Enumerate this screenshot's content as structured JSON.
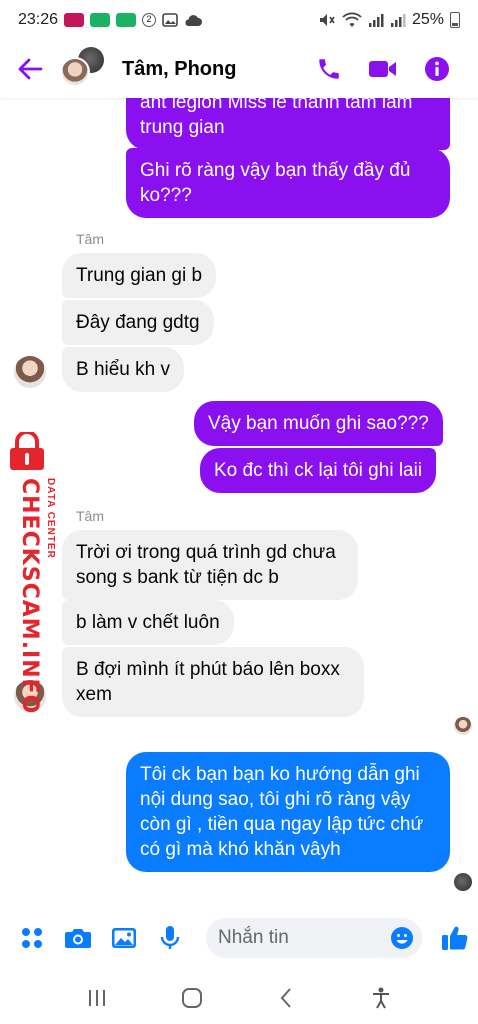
{
  "status_bar": {
    "time": "23:26",
    "battery": "25%"
  },
  "header": {
    "title": "Tâm, Phong"
  },
  "colors": {
    "accent": "#8a10f0",
    "outgoing_purple": "#8a10f0",
    "outgoing_blue": "#0a7cff",
    "incoming_bg": "#f0f0f0",
    "watermark_red": "#e4262c"
  },
  "messages": [
    {
      "text": "ant legion Miss le thanh tam lam trung gian"
    },
    {
      "text": "Ghi rõ ràng vậy bạn thấy đầy đủ ko???"
    },
    {
      "sender": "Tâm"
    },
    {
      "text": "Trung gian gi b"
    },
    {
      "text": "Đây đang gdtg"
    },
    {
      "text": "B hiểu kh v"
    },
    {
      "text": "Vậy bạn muốn ghi sao???"
    },
    {
      "text": "Ko đc thì ck lại tôi ghi laii"
    },
    {
      "sender": "Tâm"
    },
    {
      "text": "Trời ơi trong quá trình gd chưa song s bank từ tiện dc b"
    },
    {
      "text": "b làm v chết luôn"
    },
    {
      "text": "B đợi mình ít phút báo lên boxx xem"
    },
    {
      "text": "Tôi ck bạn bạn ko hướng dẫn ghi nội dung sao, tôi ghi rõ ràng vậy còn gì , tiền qua ngay lập tức chứ có gì mà khó khăn vâyh"
    }
  ],
  "watermark": {
    "main": "CHECKSCAM.INFO",
    "sub": "DATA CENTER"
  },
  "composer": {
    "placeholder": "Nhắn tin"
  },
  "icons": [
    "back-arrow-icon",
    "phone-icon",
    "video-icon",
    "info-icon",
    "apps-grid-icon",
    "camera-icon",
    "gallery-icon",
    "microphone-icon",
    "emoji-icon",
    "thumbs-up-icon",
    "recent-apps-icon",
    "home-icon",
    "back-icon",
    "accessibility-icon"
  ]
}
